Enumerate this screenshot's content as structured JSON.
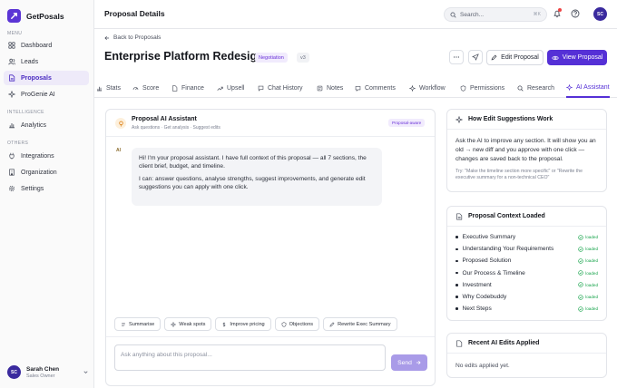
{
  "app": {
    "name": "GetPosals"
  },
  "sidebar": {
    "sections": [
      {
        "title": "MENU",
        "items": [
          {
            "label": "Dashboard",
            "icon": "grid-icon"
          },
          {
            "label": "Leads",
            "icon": "users-icon"
          },
          {
            "label": "Proposals",
            "icon": "file-icon",
            "active": true
          },
          {
            "label": "ProGenie AI",
            "icon": "sparkle-icon"
          }
        ]
      },
      {
        "title": "INTELLIGENCE",
        "items": [
          {
            "label": "Analytics",
            "icon": "chart-icon"
          }
        ]
      },
      {
        "title": "OTHERS",
        "items": [
          {
            "label": "Integrations",
            "icon": "plug-icon"
          },
          {
            "label": "Organization",
            "icon": "building-icon"
          },
          {
            "label": "Settings",
            "icon": "gear-icon"
          }
        ]
      }
    ],
    "user": {
      "initials": "SC",
      "name": "Sarah Chen",
      "role": "Sales Owner"
    }
  },
  "topbar": {
    "title": "Proposal Details",
    "search_placeholder": "Search...",
    "shortcut": "⌘K",
    "avatar_initials": "SC"
  },
  "header": {
    "back_label": "Back to Proposals",
    "title": "Enterprise Platform Redesign",
    "stage": "Negotiation",
    "version": "v3",
    "edit_label": "Edit Proposal",
    "view_label": "View Proposal"
  },
  "tabs": [
    {
      "label": "Stats",
      "icon": "bar-chart-icon"
    },
    {
      "label": "Score",
      "icon": "gauge-icon"
    },
    {
      "label": "Finance",
      "icon": "document-icon"
    },
    {
      "label": "Upsell",
      "icon": "trend-up-icon"
    },
    {
      "label": "Chat History",
      "icon": "message-icon"
    },
    {
      "label": "Notes",
      "icon": "note-icon"
    },
    {
      "label": "Comments",
      "icon": "comment-icon"
    },
    {
      "label": "Workflow",
      "icon": "workflow-icon"
    },
    {
      "label": "Permissions",
      "icon": "shield-icon"
    },
    {
      "label": "Research",
      "icon": "search-icon"
    },
    {
      "label": "AI Assistant",
      "icon": "sparkle-icon",
      "active": true
    }
  ],
  "assistant": {
    "title": "Proposal AI Assistant",
    "subtitle": "Ask questions · Get analysis · Suggest edits",
    "badge": "Proposal-aware",
    "sender_tag": "AI",
    "message_p1": "Hi! I'm your proposal assistant. I have full context of this proposal — all 7 sections, the client brief, budget, and timeline.",
    "message_p2": "I can: answer questions, analyse strengths, suggest improvements, and generate edit suggestions you can apply with one click.",
    "quick_actions": [
      {
        "label": "Summarise",
        "icon": "list-icon"
      },
      {
        "label": "Weak spots",
        "icon": "target-icon"
      },
      {
        "label": "Improve pricing",
        "icon": "dollar-icon"
      },
      {
        "label": "Objections",
        "icon": "shield-icon"
      },
      {
        "label": "Rewrite Exec Summary",
        "icon": "pencil-icon"
      }
    ],
    "input_placeholder": "Ask anything about this proposal...",
    "send_label": "Send"
  },
  "edit_suggestions_card": {
    "title": "How Edit Suggestions Work",
    "body": "Ask the AI to improve any section. It will show you an old → new diff and you approve with one click — changes are saved back to the proposal.",
    "hint": "Try: \"Make the timeline section more specific\" or \"Rewrite the executive summary for a non-technical CEO\""
  },
  "context_card": {
    "title": "Proposal Context Loaded",
    "status_label": "loaded",
    "sections": [
      "Executive Summary",
      "Understanding Your Requirements",
      "Proposed Solution",
      "Our Process & Timeline",
      "Investment",
      "Why Codebuddy",
      "Next Steps"
    ]
  },
  "edits_card": {
    "title": "Recent AI Edits Applied",
    "empty": "No edits applied yet."
  },
  "colors": {
    "accent": "#5530d6",
    "accent_light": "#f1ebfd",
    "success": "#16a34a",
    "send_disabled": "#a99be8"
  }
}
